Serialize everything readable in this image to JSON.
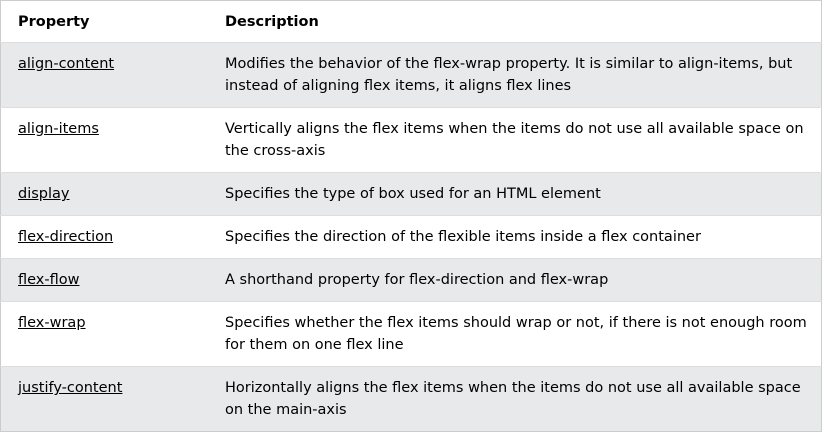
{
  "headers": {
    "property": "Property",
    "description": "Description"
  },
  "rows": [
    {
      "property": "align-content",
      "description": "Modifies the behavior of the flex-wrap property. It is similar to align-items, but instead of aligning flex items, it aligns flex lines"
    },
    {
      "property": "align-items",
      "description": "Vertically aligns the flex items when the items do not use all available space on the cross-axis"
    },
    {
      "property": "display",
      "description": "Specifies the type of box used for an HTML element"
    },
    {
      "property": "flex-direction",
      "description": "Specifies the direction of the flexible items inside a flex container"
    },
    {
      "property": "flex-flow",
      "description": "A shorthand property for flex-direction and flex-wrap"
    },
    {
      "property": "flex-wrap",
      "description": "Specifies whether the flex items should wrap or not, if there is not enough room for them on one flex line"
    },
    {
      "property": "justify-content",
      "description": "Horizontally aligns the flex items when the items do not use all available space on the main-axis"
    }
  ]
}
